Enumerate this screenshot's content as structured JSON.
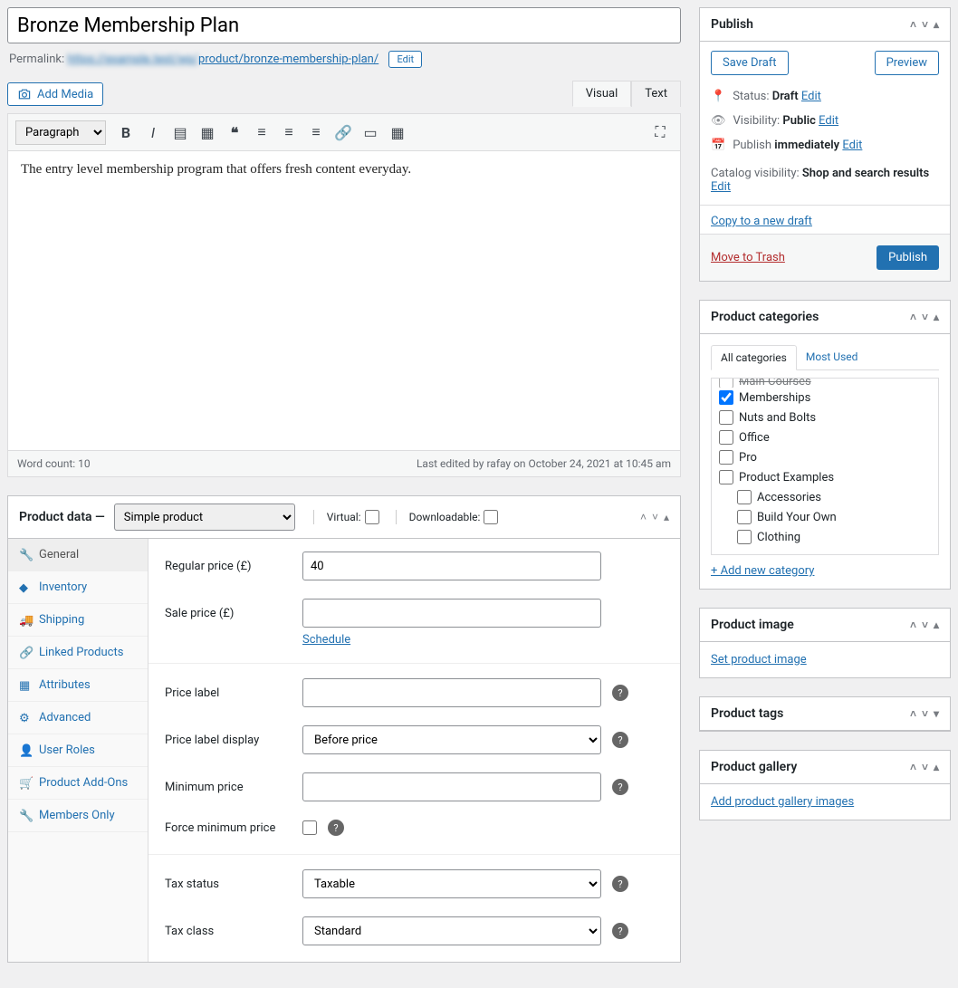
{
  "title": "Bronze Membership Plan",
  "permalink": {
    "label": "Permalink:",
    "blurred": "https://example.test/wp/",
    "path": "product/bronze-membership-plan/",
    "edit": "Edit"
  },
  "add_media": "Add Media",
  "editor": {
    "tabs": {
      "visual": "Visual",
      "text": "Text"
    },
    "format_select": "Paragraph",
    "content": "The entry level membership program that offers fresh content everyday.",
    "word_count_label": "Word count: 10",
    "last_edited": "Last edited by rafay on October 24, 2021 at 10:45 am"
  },
  "product_data": {
    "title": "Product data —",
    "type": "Simple product",
    "virtual": "Virtual:",
    "downloadable": "Downloadable:",
    "tabs": [
      "General",
      "Inventory",
      "Shipping",
      "Linked Products",
      "Attributes",
      "Advanced",
      "User Roles",
      "Product Add-Ons",
      "Members Only"
    ],
    "fields": {
      "regular_price_label": "Regular price (£)",
      "regular_price_value": "40",
      "sale_price_label": "Sale price (£)",
      "schedule": "Schedule",
      "price_label": "Price label",
      "price_label_display": "Price label display",
      "price_label_display_value": "Before price",
      "minimum_price": "Minimum price",
      "force_min": "Force minimum price",
      "tax_status": "Tax status",
      "tax_status_value": "Taxable",
      "tax_class": "Tax class",
      "tax_class_value": "Standard"
    }
  },
  "publish": {
    "title": "Publish",
    "save_draft": "Save Draft",
    "preview": "Preview",
    "status_label": "Status:",
    "status_value": "Draft",
    "visibility_label": "Visibility:",
    "visibility_value": "Public",
    "publish_label": "Publish",
    "publish_value": "immediately",
    "catalog_label": "Catalog visibility:",
    "catalog_value": "Shop and search results",
    "edit": "Edit",
    "copy": "Copy to a new draft",
    "trash": "Move to Trash",
    "publish_btn": "Publish"
  },
  "categories": {
    "title": "Product categories",
    "tabs": {
      "all": "All categories",
      "most": "Most Used"
    },
    "list": [
      {
        "label": "Main Courses",
        "checked": false,
        "hidden": true
      },
      {
        "label": "Memberships",
        "checked": true
      },
      {
        "label": "Nuts and Bolts",
        "checked": false
      },
      {
        "label": "Office",
        "checked": false
      },
      {
        "label": "Pro",
        "checked": false
      },
      {
        "label": "Product Examples",
        "checked": false
      },
      {
        "label": "Accessories",
        "checked": false,
        "child": true
      },
      {
        "label": "Build Your Own",
        "checked": false,
        "child": true
      },
      {
        "label": "Clothing",
        "checked": false,
        "child": true
      }
    ],
    "add": "+ Add new category"
  },
  "product_image": {
    "title": "Product image",
    "link": "Set product image"
  },
  "product_tags": {
    "title": "Product tags"
  },
  "product_gallery": {
    "title": "Product gallery",
    "link": "Add product gallery images"
  }
}
